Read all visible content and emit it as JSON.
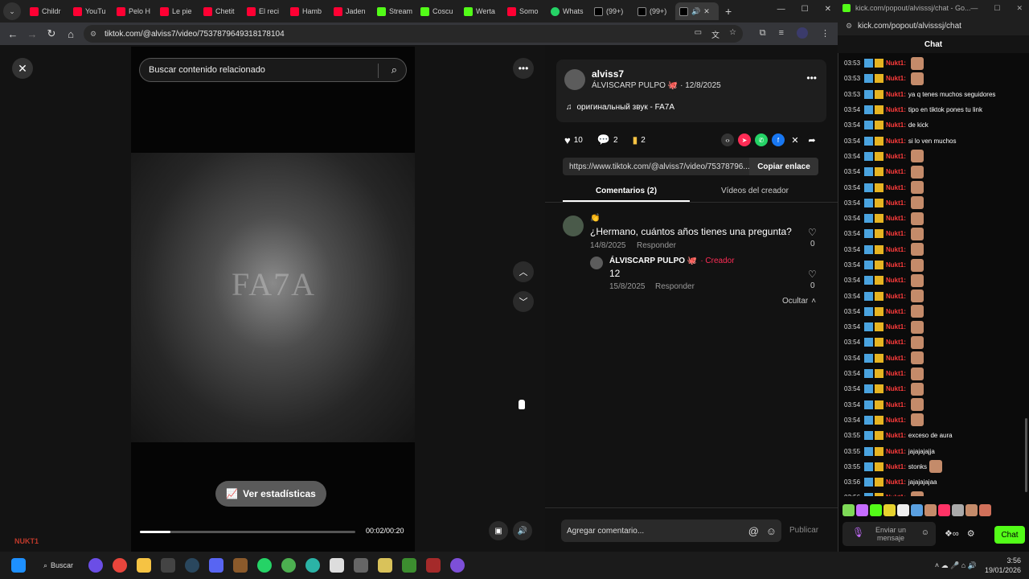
{
  "browser": {
    "tabs": [
      {
        "label": "Childr",
        "icon": "youtube-icon"
      },
      {
        "label": "YouTu",
        "icon": "youtube-icon"
      },
      {
        "label": "Pelo H",
        "icon": "youtube-icon"
      },
      {
        "label": "Le pie",
        "icon": "youtube-icon"
      },
      {
        "label": "Chetit",
        "icon": "youtube-icon"
      },
      {
        "label": "El reci",
        "icon": "youtube-icon"
      },
      {
        "label": "Hamb",
        "icon": "youtube-icon"
      },
      {
        "label": "Jaden",
        "icon": "youtube-icon"
      },
      {
        "label": "Stream",
        "icon": "kick-icon"
      },
      {
        "label": "Coscu",
        "icon": "kick-icon"
      },
      {
        "label": "Werta",
        "icon": "kick-icon"
      },
      {
        "label": "Somo",
        "icon": "youtube-icon"
      },
      {
        "label": "Whats",
        "icon": "whatsapp-icon"
      },
      {
        "label": "(99+)",
        "icon": "tiktok-icon"
      },
      {
        "label": "(99+)",
        "icon": "tiktok-icon"
      }
    ],
    "url": "tiktok.com/@alviss7/video/7537879649318178104"
  },
  "video": {
    "search_placeholder": "Buscar contenido relacionado",
    "stats_label": "Ver estadísticas",
    "time": "00:02/00:20",
    "progress": 0.14,
    "watermark": "FA7A"
  },
  "post": {
    "username": "alviss7",
    "display_name": "ÁLVISCARP PULPO 🐙",
    "date": "· 12/8/2025",
    "sound": "оригинальный звук - FA7A",
    "likes": "10",
    "comments": "2",
    "saves": "2",
    "link": "https://www.tiktok.com/@alviss7/video/75378796...",
    "copy_label": "Copiar enlace",
    "tab_comments": "Comentarios (2)",
    "tab_creator": "Vídeos del creador",
    "comment_placeholder": "Agregar comentario...",
    "publish_label": "Publicar"
  },
  "comments": [
    {
      "emoji": "👏",
      "text": "¿Hermano, cuántos años tienes una pregunta?",
      "date": "14/8/2025",
      "reply": "Responder",
      "likes": "0"
    },
    {
      "author": "ÁLVISCARP PULPO 🐙",
      "creator_tag": "· Creador",
      "text": "12",
      "date": "15/8/2025",
      "reply": "Responder",
      "likes": "0"
    }
  ],
  "hide_label": "Ocultar",
  "chat": {
    "window_title": "kick.com/popout/alvisssj/chat - Go...",
    "url": "kick.com/popout/alvisssj/chat",
    "header": "Chat",
    "input_placeholder": "Enviar un mensaje",
    "send_label": "Chat",
    "messages": [
      {
        "time": "03:53",
        "user": "Nukt1:",
        "text": "",
        "emote": true
      },
      {
        "time": "03:53",
        "user": "Nukt1:",
        "text": "",
        "emote": true
      },
      {
        "time": "03:53",
        "user": "Nukt1:",
        "text": "ya q tenes muchos seguidores",
        "emote": false
      },
      {
        "time": "03:54",
        "user": "Nukt1:",
        "text": "tipo en tiktok pones tu link",
        "emote": false
      },
      {
        "time": "03:54",
        "user": "Nukt1:",
        "text": "de kick",
        "emote": false
      },
      {
        "time": "03:54",
        "user": "Nukt1:",
        "text": "si lo ven muchos",
        "emote": false
      },
      {
        "time": "03:54",
        "user": "Nukt1:",
        "text": "",
        "emote": true
      },
      {
        "time": "03:54",
        "user": "Nukt1:",
        "text": "",
        "emote": true
      },
      {
        "time": "03:54",
        "user": "Nukt1:",
        "text": "",
        "emote": true
      },
      {
        "time": "03:54",
        "user": "Nukt1:",
        "text": "",
        "emote": true
      },
      {
        "time": "03:54",
        "user": "Nukt1:",
        "text": "",
        "emote": true
      },
      {
        "time": "03:54",
        "user": "Nukt1:",
        "text": "",
        "emote": true
      },
      {
        "time": "03:54",
        "user": "Nukt1:",
        "text": "",
        "emote": true
      },
      {
        "time": "03:54",
        "user": "Nukt1:",
        "text": "",
        "emote": true
      },
      {
        "time": "03:54",
        "user": "Nukt1:",
        "text": "",
        "emote": true
      },
      {
        "time": "03:54",
        "user": "Nukt1:",
        "text": "",
        "emote": true
      },
      {
        "time": "03:54",
        "user": "Nukt1:",
        "text": "",
        "emote": true
      },
      {
        "time": "03:54",
        "user": "Nukt1:",
        "text": "",
        "emote": true
      },
      {
        "time": "03:54",
        "user": "Nukt1:",
        "text": "",
        "emote": true
      },
      {
        "time": "03:54",
        "user": "Nukt1:",
        "text": "",
        "emote": true
      },
      {
        "time": "03:54",
        "user": "Nukt1:",
        "text": "",
        "emote": true
      },
      {
        "time": "03:54",
        "user": "Nukt1:",
        "text": "",
        "emote": true
      },
      {
        "time": "03:54",
        "user": "Nukt1:",
        "text": "",
        "emote": true
      },
      {
        "time": "03:54",
        "user": "Nukt1:",
        "text": "",
        "emote": true
      },
      {
        "time": "03:55",
        "user": "Nukt1:",
        "text": "exceso de aura",
        "emote": false
      },
      {
        "time": "03:55",
        "user": "Nukt1:",
        "text": "jajajajajja",
        "emote": false
      },
      {
        "time": "03:55",
        "user": "Nukt1:",
        "text": "stonks",
        "emote": true
      },
      {
        "time": "03:56",
        "user": "Nukt1:",
        "text": "jajajajajaa",
        "emote": false
      },
      {
        "time": "03:56",
        "user": "Nukt1:",
        "text": "",
        "emote": true
      }
    ]
  },
  "taskbar": {
    "search_label": "Buscar",
    "time": "3:56",
    "date": "19/01/2026",
    "user_label": "NUKT1"
  },
  "colors": {
    "tiktok_red": "#fe2c55",
    "kick_green": "#53fc18",
    "chat_user": "#ff3b3b"
  }
}
